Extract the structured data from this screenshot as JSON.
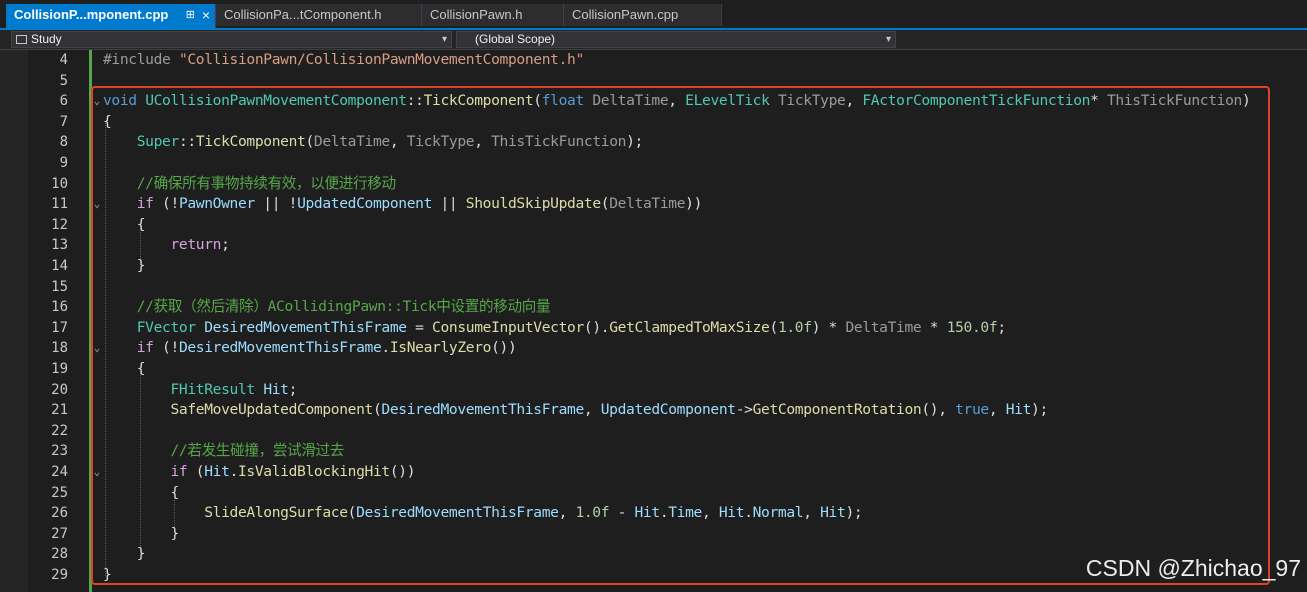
{
  "tabs": [
    {
      "label": "CollisionP...mponent.cpp",
      "active": true,
      "pin": "⊞",
      "close": "×"
    },
    {
      "label": "CollisionPa...tComponent.h",
      "active": false
    },
    {
      "label": "CollisionPawn.h",
      "active": false
    },
    {
      "label": "CollisionPawn.cpp",
      "active": false
    }
  ],
  "navbar": {
    "project": "Study",
    "scope": "(Global Scope)"
  },
  "lines": [
    {
      "n": "4",
      "code": "#include \"CollisionPawn/CollisionPawnMovementComponent.h\""
    },
    {
      "n": "5",
      "code": ""
    },
    {
      "n": "6",
      "code": "void UCollisionPawnMovementComponent::TickComponent(float DeltaTime, ELevelTick TickType, FActorComponentTickFunction* ThisTickFunction)"
    },
    {
      "n": "7",
      "code": "{"
    },
    {
      "n": "8",
      "code": "    Super::TickComponent(DeltaTime, TickType, ThisTickFunction);"
    },
    {
      "n": "9",
      "code": ""
    },
    {
      "n": "10",
      "code": "    //确保所有事物持续有效，以便进行移动"
    },
    {
      "n": "11",
      "code": "    if (!PawnOwner || !UpdatedComponent || ShouldSkipUpdate(DeltaTime))"
    },
    {
      "n": "12",
      "code": "    {"
    },
    {
      "n": "13",
      "code": "        return;"
    },
    {
      "n": "14",
      "code": "    }"
    },
    {
      "n": "15",
      "code": ""
    },
    {
      "n": "16",
      "code": "    //获取（然后清除）ACollidingPawn::Tick中设置的移动向量"
    },
    {
      "n": "17",
      "code": "    FVector DesiredMovementThisFrame = ConsumeInputVector().GetClampedToMaxSize(1.0f) * DeltaTime * 150.0f;"
    },
    {
      "n": "18",
      "code": "    if (!DesiredMovementThisFrame.IsNearlyZero())"
    },
    {
      "n": "19",
      "code": "    {"
    },
    {
      "n": "20",
      "code": "        FHitResult Hit;"
    },
    {
      "n": "21",
      "code": "        SafeMoveUpdatedComponent(DesiredMovementThisFrame, UpdatedComponent->GetComponentRotation(), true, Hit);"
    },
    {
      "n": "22",
      "code": ""
    },
    {
      "n": "23",
      "code": "        //若发生碰撞，尝试滑过去"
    },
    {
      "n": "24",
      "code": "        if (Hit.IsValidBlockingHit())"
    },
    {
      "n": "25",
      "code": "        {"
    },
    {
      "n": "26",
      "code": "            SlideAlongSurface(DesiredMovementThisFrame, 1.0f - Hit.Time, Hit.Normal, Hit);"
    },
    {
      "n": "27",
      "code": "        }"
    },
    {
      "n": "28",
      "code": "    }"
    },
    {
      "n": "29",
      "code": "}"
    }
  ],
  "watermark": "CSDN @Zhichao_97",
  "colors": {
    "keyword": "#569cd6",
    "type": "#4ec9b0",
    "function": "#dcdcaa",
    "comment": "#57a64a",
    "string": "#d69d85",
    "number": "#b5cea8",
    "highlight_box": "#e0412b",
    "accent": "#007acc"
  }
}
